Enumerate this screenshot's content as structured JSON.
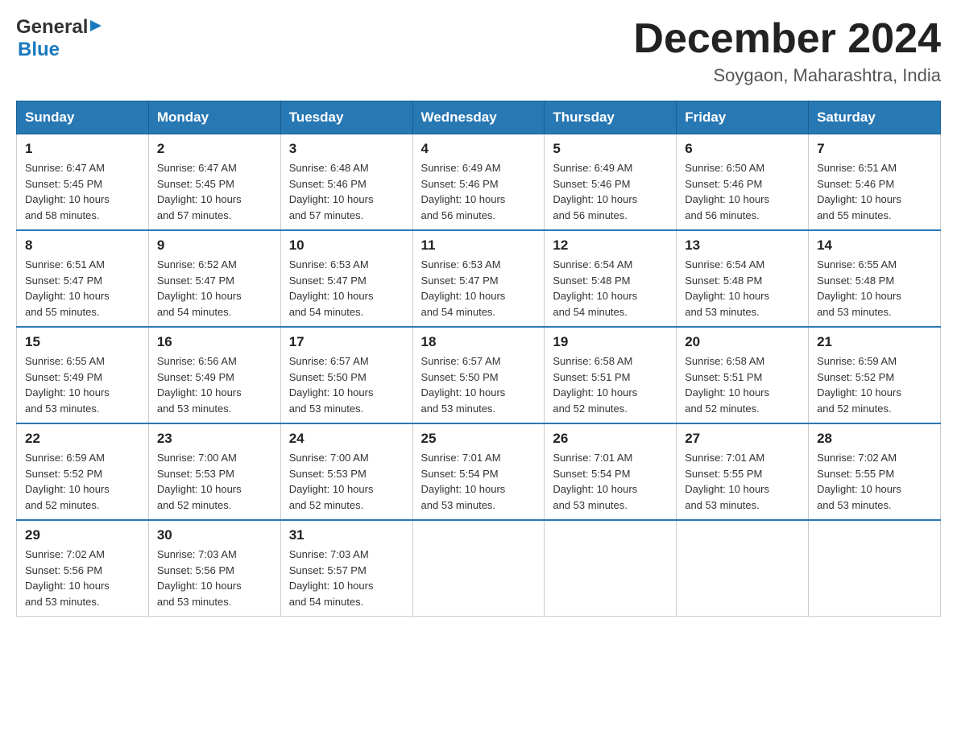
{
  "header": {
    "logo_general": "General",
    "logo_blue": "Blue",
    "title": "December 2024",
    "subtitle": "Soygaon, Maharashtra, India"
  },
  "days_of_week": [
    "Sunday",
    "Monday",
    "Tuesday",
    "Wednesday",
    "Thursday",
    "Friday",
    "Saturday"
  ],
  "weeks": [
    [
      {
        "day": "1",
        "sunrise": "6:47 AM",
        "sunset": "5:45 PM",
        "daylight": "10 hours and 58 minutes."
      },
      {
        "day": "2",
        "sunrise": "6:47 AM",
        "sunset": "5:45 PM",
        "daylight": "10 hours and 57 minutes."
      },
      {
        "day": "3",
        "sunrise": "6:48 AM",
        "sunset": "5:46 PM",
        "daylight": "10 hours and 57 minutes."
      },
      {
        "day": "4",
        "sunrise": "6:49 AM",
        "sunset": "5:46 PM",
        "daylight": "10 hours and 56 minutes."
      },
      {
        "day": "5",
        "sunrise": "6:49 AM",
        "sunset": "5:46 PM",
        "daylight": "10 hours and 56 minutes."
      },
      {
        "day": "6",
        "sunrise": "6:50 AM",
        "sunset": "5:46 PM",
        "daylight": "10 hours and 56 minutes."
      },
      {
        "day": "7",
        "sunrise": "6:51 AM",
        "sunset": "5:46 PM",
        "daylight": "10 hours and 55 minutes."
      }
    ],
    [
      {
        "day": "8",
        "sunrise": "6:51 AM",
        "sunset": "5:47 PM",
        "daylight": "10 hours and 55 minutes."
      },
      {
        "day": "9",
        "sunrise": "6:52 AM",
        "sunset": "5:47 PM",
        "daylight": "10 hours and 54 minutes."
      },
      {
        "day": "10",
        "sunrise": "6:53 AM",
        "sunset": "5:47 PM",
        "daylight": "10 hours and 54 minutes."
      },
      {
        "day": "11",
        "sunrise": "6:53 AM",
        "sunset": "5:47 PM",
        "daylight": "10 hours and 54 minutes."
      },
      {
        "day": "12",
        "sunrise": "6:54 AM",
        "sunset": "5:48 PM",
        "daylight": "10 hours and 54 minutes."
      },
      {
        "day": "13",
        "sunrise": "6:54 AM",
        "sunset": "5:48 PM",
        "daylight": "10 hours and 53 minutes."
      },
      {
        "day": "14",
        "sunrise": "6:55 AM",
        "sunset": "5:48 PM",
        "daylight": "10 hours and 53 minutes."
      }
    ],
    [
      {
        "day": "15",
        "sunrise": "6:55 AM",
        "sunset": "5:49 PM",
        "daylight": "10 hours and 53 minutes."
      },
      {
        "day": "16",
        "sunrise": "6:56 AM",
        "sunset": "5:49 PM",
        "daylight": "10 hours and 53 minutes."
      },
      {
        "day": "17",
        "sunrise": "6:57 AM",
        "sunset": "5:50 PM",
        "daylight": "10 hours and 53 minutes."
      },
      {
        "day": "18",
        "sunrise": "6:57 AM",
        "sunset": "5:50 PM",
        "daylight": "10 hours and 53 minutes."
      },
      {
        "day": "19",
        "sunrise": "6:58 AM",
        "sunset": "5:51 PM",
        "daylight": "10 hours and 52 minutes."
      },
      {
        "day": "20",
        "sunrise": "6:58 AM",
        "sunset": "5:51 PM",
        "daylight": "10 hours and 52 minutes."
      },
      {
        "day": "21",
        "sunrise": "6:59 AM",
        "sunset": "5:52 PM",
        "daylight": "10 hours and 52 minutes."
      }
    ],
    [
      {
        "day": "22",
        "sunrise": "6:59 AM",
        "sunset": "5:52 PM",
        "daylight": "10 hours and 52 minutes."
      },
      {
        "day": "23",
        "sunrise": "7:00 AM",
        "sunset": "5:53 PM",
        "daylight": "10 hours and 52 minutes."
      },
      {
        "day": "24",
        "sunrise": "7:00 AM",
        "sunset": "5:53 PM",
        "daylight": "10 hours and 52 minutes."
      },
      {
        "day": "25",
        "sunrise": "7:01 AM",
        "sunset": "5:54 PM",
        "daylight": "10 hours and 53 minutes."
      },
      {
        "day": "26",
        "sunrise": "7:01 AM",
        "sunset": "5:54 PM",
        "daylight": "10 hours and 53 minutes."
      },
      {
        "day": "27",
        "sunrise": "7:01 AM",
        "sunset": "5:55 PM",
        "daylight": "10 hours and 53 minutes."
      },
      {
        "day": "28",
        "sunrise": "7:02 AM",
        "sunset": "5:55 PM",
        "daylight": "10 hours and 53 minutes."
      }
    ],
    [
      {
        "day": "29",
        "sunrise": "7:02 AM",
        "sunset": "5:56 PM",
        "daylight": "10 hours and 53 minutes."
      },
      {
        "day": "30",
        "sunrise": "7:03 AM",
        "sunset": "5:56 PM",
        "daylight": "10 hours and 53 minutes."
      },
      {
        "day": "31",
        "sunrise": "7:03 AM",
        "sunset": "5:57 PM",
        "daylight": "10 hours and 54 minutes."
      },
      null,
      null,
      null,
      null
    ]
  ],
  "labels": {
    "sunrise": "Sunrise:",
    "sunset": "Sunset:",
    "daylight": "Daylight:"
  }
}
